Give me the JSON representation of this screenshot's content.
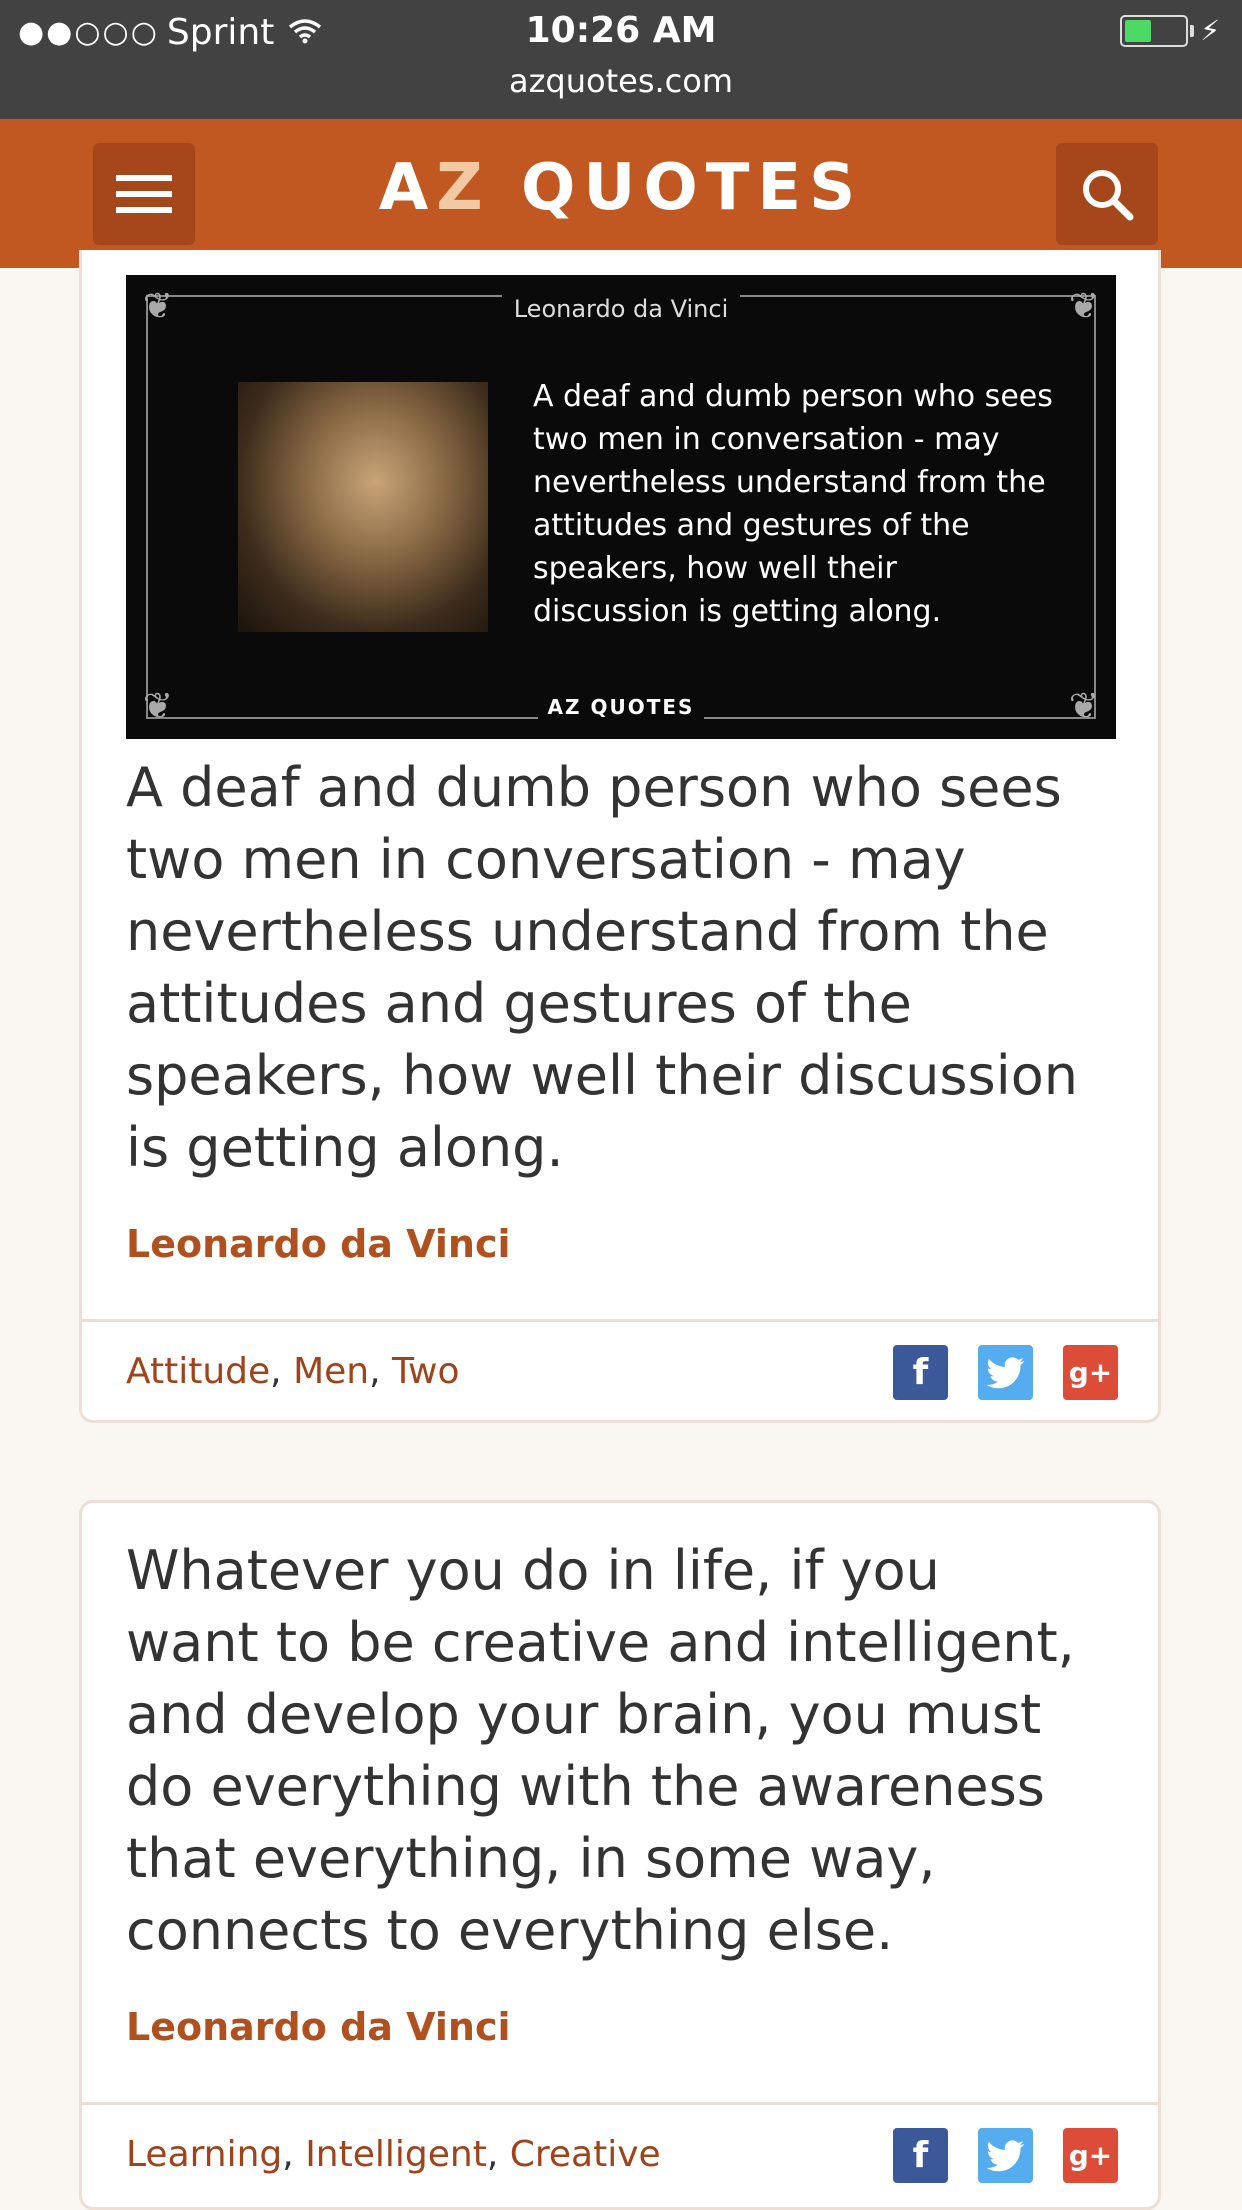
{
  "status_bar": {
    "signal": "●●○○○",
    "carrier": "Sprint",
    "time": "10:26 AM",
    "url": "azquotes.com",
    "battery_level": 0.45
  },
  "header": {
    "logo_a": "A",
    "logo_z": "Z",
    "logo_rest": " QUOTES"
  },
  "quotes": [
    {
      "image": {
        "author": "Leonardo da Vinci",
        "text": "A deaf and dumb person who sees two men in conversation - may nevertheless understand from the attitudes and gestures of the speakers, how well their discussion is getting along.",
        "logo": "AZ QUOTES"
      },
      "text": "A deaf and dumb person who sees two men in conversation - may nevertheless understand from the attitudes and gestures of the speakers, how well their discussion is getting along.",
      "author": "Leonardo da Vinci",
      "tags": [
        "Attitude",
        "Men",
        "Two"
      ]
    },
    {
      "text": "Whatever you do in life, if you want to be creative and intelligent, and develop your brain, you must do everything with the awareness that everything, in some way, connects to everything else.",
      "author": "Leonardo da Vinci",
      "tags": [
        "Learning",
        "Intelligent",
        "Creative"
      ]
    }
  ],
  "share": {
    "facebook": "f",
    "twitter": "t",
    "google_plus": "g+"
  }
}
